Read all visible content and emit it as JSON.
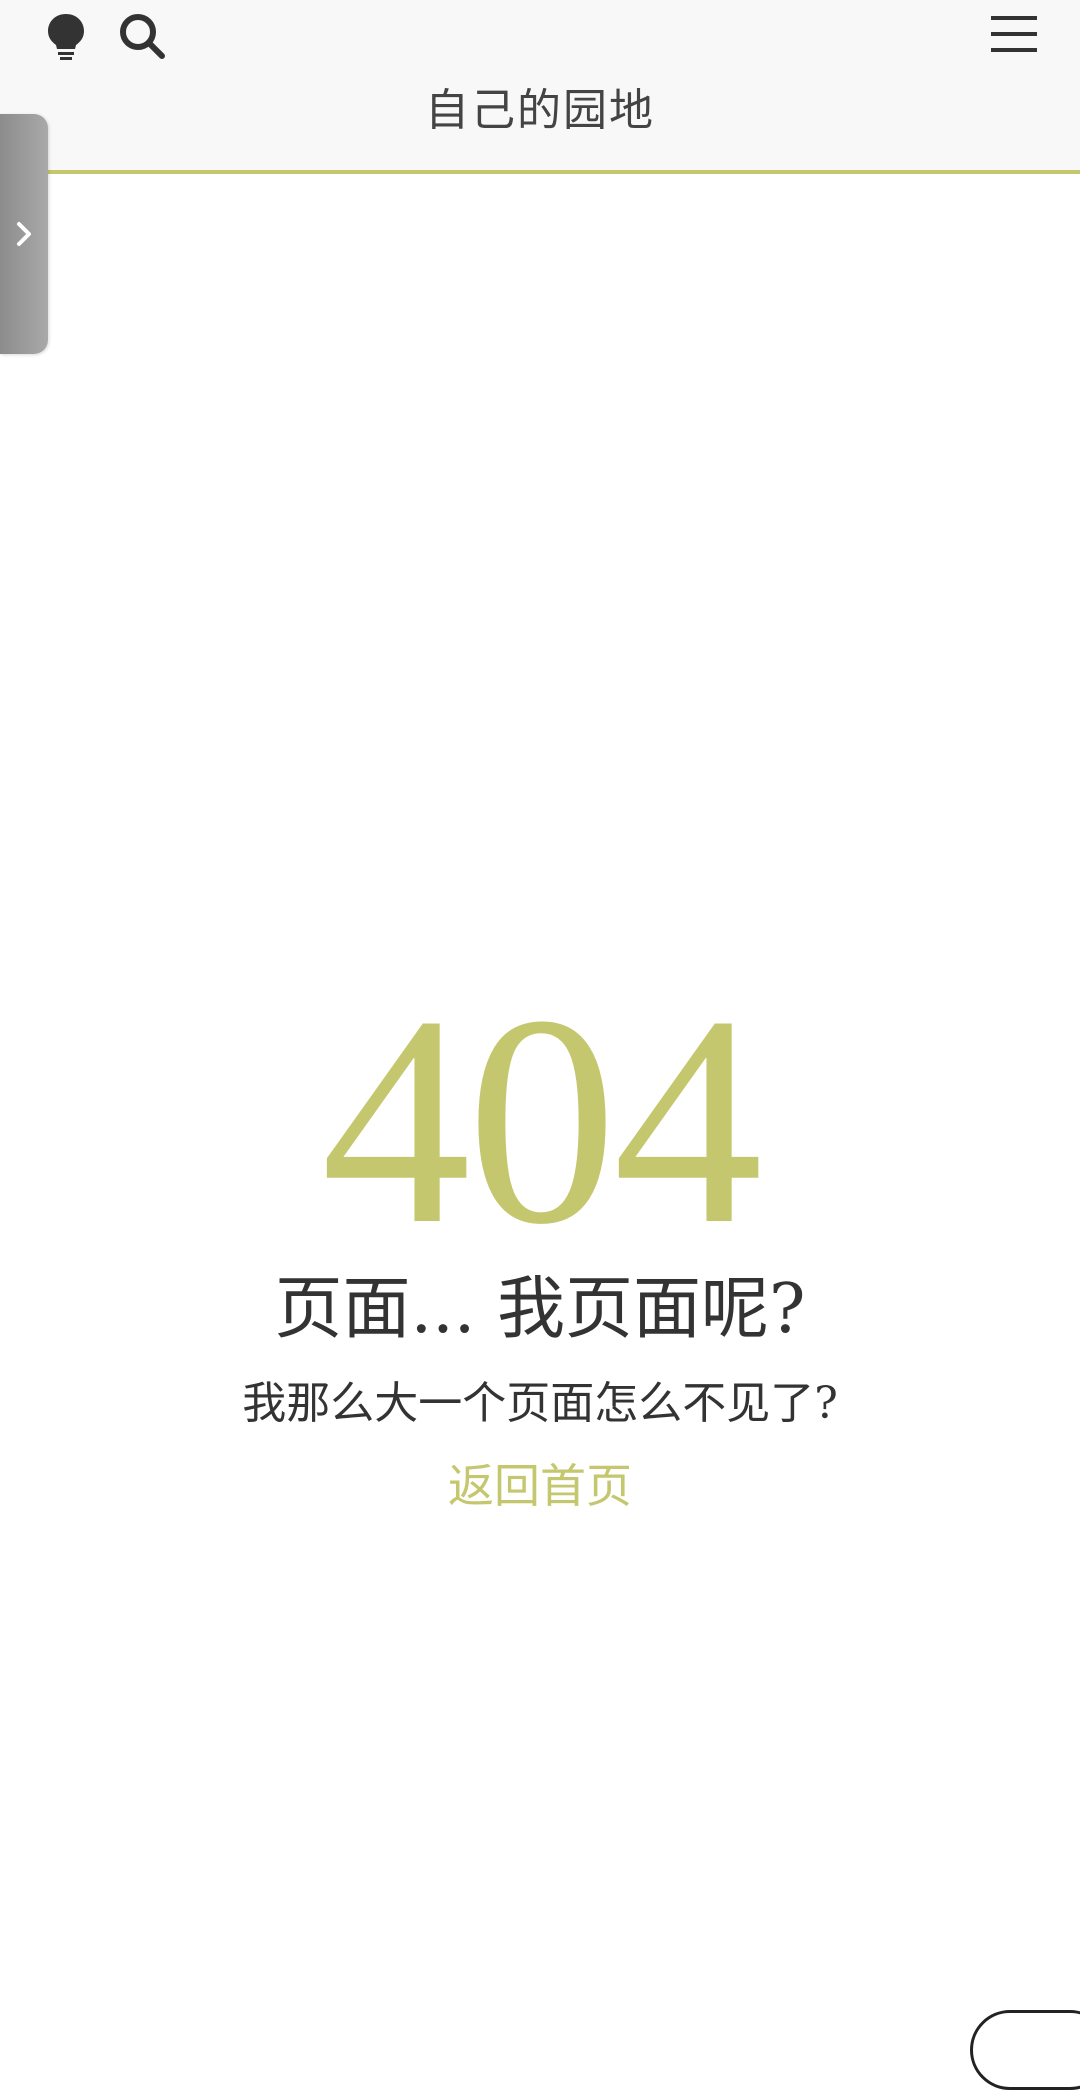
{
  "header": {
    "site_title": "自己的园地",
    "icons": {
      "theme": "lightbulb-icon",
      "search": "search-icon",
      "menu": "hamburger-menu-icon"
    }
  },
  "sidebar_toggle": {
    "icon": "chevron-right-icon"
  },
  "error": {
    "code": "404",
    "headline": "页面... 我页面呢?",
    "message": "我那么大一个页面怎么不见了?",
    "home_link": "返回首页"
  },
  "colors": {
    "accent": "#c5c76e",
    "text": "#333333",
    "header_bg": "#f8f8f8"
  }
}
